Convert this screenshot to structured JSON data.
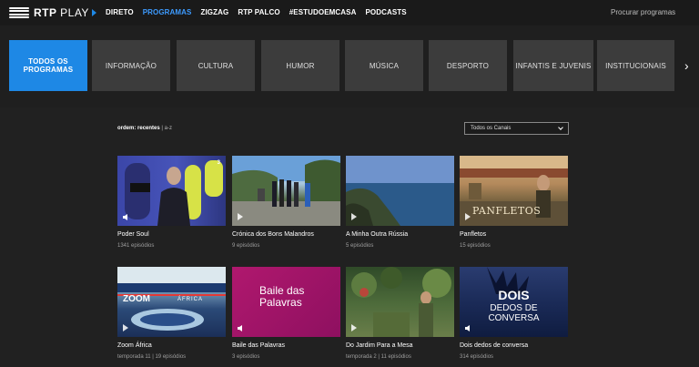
{
  "header": {
    "logo_text": "RTP",
    "logo_play": "PLAY",
    "nav": [
      {
        "label": "DIRETO",
        "active": false
      },
      {
        "label": "PROGRAMAS",
        "active": true
      },
      {
        "label": "ZIGZAG",
        "active": false
      },
      {
        "label": "RTP PALCO",
        "active": false
      },
      {
        "label": "#ESTUDOEMCASA",
        "active": false
      },
      {
        "label": "PODCASTS",
        "active": false
      }
    ],
    "search_label": "Procurar programas"
  },
  "categories": [
    {
      "label": "TODOS OS PROGRAMAS",
      "active": true
    },
    {
      "label": "INFORMAÇÃO",
      "active": false
    },
    {
      "label": "CULTURA",
      "active": false
    },
    {
      "label": "HUMOR",
      "active": false
    },
    {
      "label": "MÚSICA",
      "active": false
    },
    {
      "label": "DESPORTO",
      "active": false
    },
    {
      "label": "INFANTIS E JUVENIS",
      "active": false
    },
    {
      "label": "INSTITUCIONAIS",
      "active": false
    }
  ],
  "categories_next": "›",
  "sort": {
    "label": "ordem:",
    "recentes": "recentes",
    "separator": "|",
    "az": "a-z"
  },
  "channel_filter": {
    "selected": "Todos os Canais"
  },
  "programs": [
    {
      "title": "Poder Soul",
      "meta": "1341 episódios",
      "media": "audio",
      "badge": "3"
    },
    {
      "title": "Crónica dos Bons Malandros",
      "meta": "9 episódios",
      "media": "video"
    },
    {
      "title": "A Minha Outra Rússia",
      "meta": "5 episódios",
      "media": "video"
    },
    {
      "title": "Panfletos",
      "meta": "15 episódios",
      "media": "video",
      "overlay": "PANFLETOS"
    },
    {
      "title": "Zoom África",
      "meta": "temporada 11 | 19 episódios",
      "media": "video",
      "overlay": "ZOOM",
      "overlay2": "ÁFRICA"
    },
    {
      "title": "Baile das Palavras",
      "meta": "3 episódios",
      "media": "audio",
      "overlay": "Baile das Palavras"
    },
    {
      "title": "Do Jardim Para a Mesa",
      "meta": "temporada 2 | 11 episódios",
      "media": "video"
    },
    {
      "title": "Dois dedos de conversa",
      "meta": "314 episódios",
      "media": "audio",
      "overlay": "DOIS",
      "overlay2": "DEDOS DE",
      "overlay3": "CONVERSA"
    }
  ],
  "colors": {
    "accent": "#1e88e5",
    "nav_active": "#3d9bff",
    "background": "#212121"
  }
}
